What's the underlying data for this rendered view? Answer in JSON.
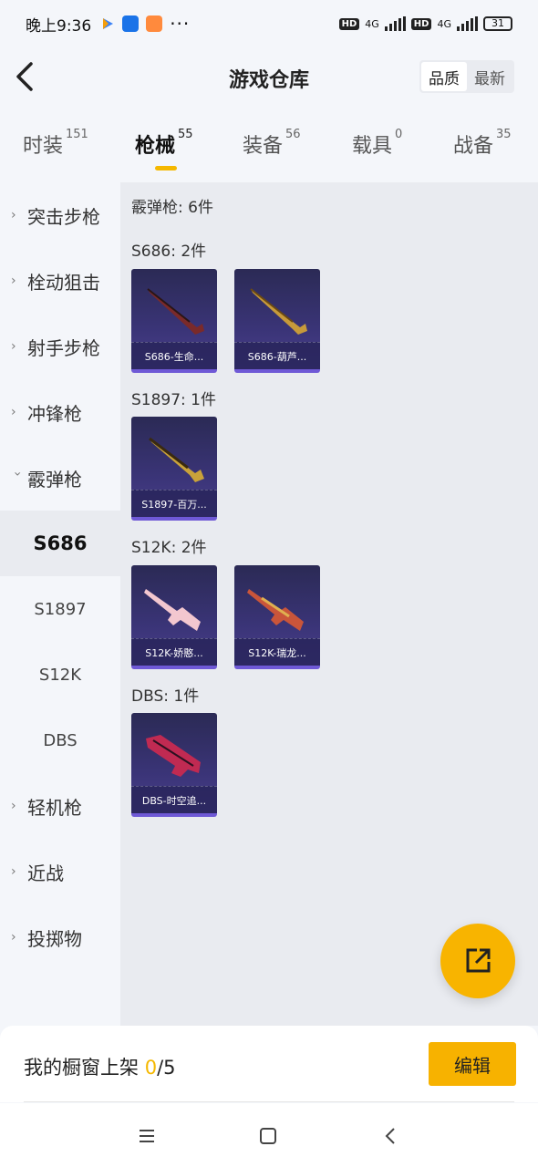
{
  "status": {
    "time": "晚上9:36",
    "network1": "4G",
    "network2": "4G",
    "battery": "31",
    "hd": "HD"
  },
  "header": {
    "title": "游戏仓库",
    "sort_quality": "品质",
    "sort_latest": "最新"
  },
  "tabs": [
    {
      "label": "时装",
      "count": "151"
    },
    {
      "label": "枪械",
      "count": "55"
    },
    {
      "label": "装备",
      "count": "56"
    },
    {
      "label": "载具",
      "count": "0"
    },
    {
      "label": "战备",
      "count": "35"
    }
  ],
  "sidebar": {
    "categories": [
      "突击步枪",
      "栓动狙击",
      "射手步枪",
      "冲锋枪",
      "霰弹枪"
    ],
    "subs": [
      "S686",
      "S1897",
      "S12K",
      "DBS"
    ],
    "categories_after": [
      "轻机枪",
      "近战",
      "投掷物"
    ]
  },
  "content": {
    "heading": "霰弹枪: 6件",
    "groups": [
      {
        "title": "S686: 2件",
        "items": [
          "S686-生命...",
          "S686-葫芦..."
        ]
      },
      {
        "title": "S1897: 1件",
        "items": [
          "S1897-百万..."
        ]
      },
      {
        "title": "S12K: 2件",
        "items": [
          "S12K-娇憨...",
          "S12K-瑞龙..."
        ]
      },
      {
        "title": "DBS: 1件",
        "items": [
          "DBS-时空追..."
        ]
      }
    ]
  },
  "bottom": {
    "label_prefix": "我的橱窗上架 ",
    "count": "0",
    "total": "/5",
    "edit": "编辑"
  },
  "colors": {
    "accent": "#f5b800",
    "card_bg": "#3a3477"
  },
  "icons": [
    "back-arrow-icon",
    "share-out-icon",
    "menu-icon",
    "home-square-icon",
    "nav-back-icon",
    "chevron-right-icon",
    "chevron-down-icon"
  ]
}
